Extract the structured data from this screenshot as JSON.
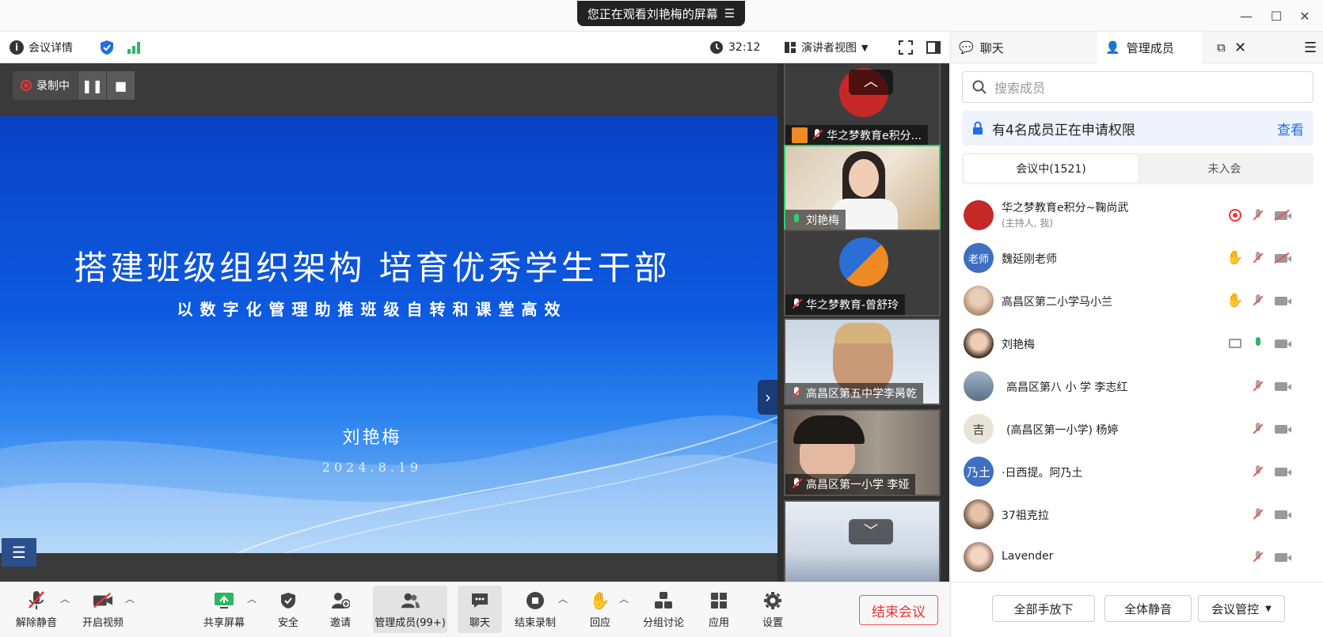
{
  "window": {
    "share_banner": "您正在观看刘艳梅的屏幕"
  },
  "infobar": {
    "meeting_details": "会议详情",
    "timer": "32:12",
    "view_mode": "演讲者视图"
  },
  "recording": {
    "label": "录制中"
  },
  "slide": {
    "title": "搭建班级组织架构  培育优秀学生干部",
    "subtitle": "以数字化管理助推班级自转和课堂高效",
    "author": "刘艳梅",
    "date": "2024.8.19"
  },
  "video_tiles": [
    {
      "name": "华之梦教育e积分..."
    },
    {
      "name": "刘艳梅"
    },
    {
      "name": "华之梦教育-曾舒玲"
    },
    {
      "name": "高昌区第五中学李昺乾"
    },
    {
      "name": "高昌区第一小学    李娅"
    }
  ],
  "panel": {
    "tab_chat": "聊天",
    "tab_members": "管理成员",
    "search_placeholder": "搜索成员",
    "notice_text": "有4名成员正在申请权限",
    "notice_link": "查看",
    "seg_in_meeting": "会议中(1521)",
    "seg_not_joined": "未入会",
    "members": [
      {
        "name": "华之梦教育e积分~鞠尚武",
        "sub": "(主持人, 我)",
        "avatar": ""
      },
      {
        "name": "魏延刚老师",
        "sub": "",
        "avatar": "老师"
      },
      {
        "name": "高昌区第二小学马小兰",
        "sub": "",
        "avatar": ""
      },
      {
        "name": "刘艳梅",
        "sub": "",
        "avatar": ""
      },
      {
        "name": "高昌区第八 小 学 李志红",
        "sub": "",
        "avatar": ""
      },
      {
        "name": "(高昌区第一小学) 杨婷",
        "sub": "",
        "avatar": "吉"
      },
      {
        "name": "·日西提。阿乃土",
        "sub": "",
        "avatar": "乃土"
      },
      {
        "name": "37祖克拉",
        "sub": "",
        "avatar": ""
      },
      {
        "name": "Lavender",
        "sub": "",
        "avatar": ""
      }
    ],
    "btn_lower_hands": "全部手放下",
    "btn_mute_all": "全体静音",
    "btn_control": "会议管控"
  },
  "toolbar": {
    "unmute": "解除静音",
    "start_video": "开启视频",
    "share": "共享屏幕",
    "security": "安全",
    "invite": "邀请",
    "members": "管理成员(99+)",
    "chat": "聊天",
    "end_recording": "结束录制",
    "reactions": "回应",
    "breakout": "分组讨论",
    "apps": "应用",
    "settings": "设置",
    "end_meeting": "结束会议"
  }
}
